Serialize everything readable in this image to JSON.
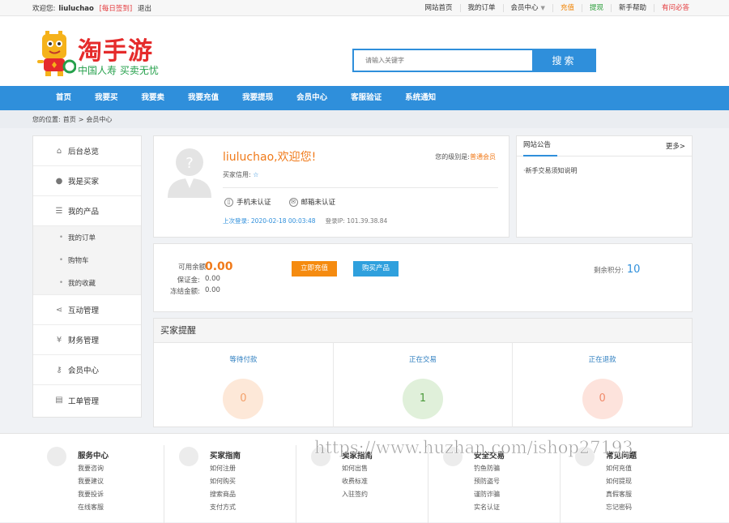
{
  "topbar": {
    "welcome": "欢迎您:",
    "username": "liuluchao",
    "daily_sign": "[每日签到]",
    "logout": "退出",
    "links": [
      "网站首页",
      "我的订单",
      "会员中心",
      "充值",
      "提现",
      "新手帮助",
      "有问必答"
    ]
  },
  "header": {
    "brand": "淘手游",
    "slogan": "中国人寿  买卖无忧",
    "search_placeholder": "请输入关键字",
    "search_button": "搜索"
  },
  "nav": [
    "首页",
    "我要买",
    "我要卖",
    "我要充值",
    "我要提现",
    "会员中心",
    "客服验证",
    "系统通知"
  ],
  "breadcrumb": {
    "label": "您的位置:",
    "home": "首页",
    "sep": ">",
    "current": "会员中心"
  },
  "sidebar": {
    "items": [
      {
        "label": "后台总览",
        "icon": "home-icon"
      },
      {
        "label": "我是买家",
        "icon": "user-icon"
      },
      {
        "label": "我的产品",
        "icon": "list-icon"
      }
    ],
    "sub_items": [
      "我的订单",
      "购物车",
      "我的收藏"
    ],
    "items2": [
      {
        "label": "互动管理",
        "icon": "share-icon"
      },
      {
        "label": "财务管理",
        "icon": "yen-icon"
      },
      {
        "label": "会员中心",
        "icon": "key-icon"
      },
      {
        "label": "工单管理",
        "icon": "clipboard-icon"
      }
    ]
  },
  "profile": {
    "welcome": "liuluchao,欢迎您!",
    "level_label": "您的级别是:",
    "level": "普通会员",
    "credit_label": "买家信用:",
    "phone_auth": "手机未认证",
    "email_auth": "邮箱未认证",
    "last_login": "上次登录:  2020-02-18 00:03:48",
    "login_ip": "登录IP:  101.39.38.84"
  },
  "notice": {
    "tab": "网站公告",
    "more": "更多>",
    "items": [
      "·新手交易须知说明"
    ]
  },
  "balance": {
    "available_label": "可用余额:",
    "available": "0.00",
    "deposit_label": "保证金:",
    "deposit": "0.00",
    "frozen_label": "冻结金额:",
    "frozen": "0.00",
    "recharge_btn": "立即充值",
    "buy_btn": "购买产品",
    "points_label": "剩余积分:",
    "points": "10"
  },
  "alert": {
    "title": "买家提醒",
    "cols": [
      {
        "label": "等待付款",
        "count": "0"
      },
      {
        "label": "正在交易",
        "count": "1"
      },
      {
        "label": "正在退款",
        "count": "0"
      }
    ]
  },
  "footer": [
    {
      "title": "服务中心",
      "links": [
        "我要咨询",
        "我要建议",
        "我要投诉",
        "在线客服"
      ]
    },
    {
      "title": "买家指南",
      "links": [
        "如何注册",
        "如何购买",
        "搜索商品",
        "支付方式"
      ]
    },
    {
      "title": "卖家指南",
      "links": [
        "如何出售",
        "收费标准",
        "入驻签约"
      ]
    },
    {
      "title": "安全交易",
      "links": [
        "钓鱼防骗",
        "预防盗号",
        "谨防诈骗",
        "实名认证"
      ]
    },
    {
      "title": "常见问题",
      "links": [
        "如何充值",
        "如何提现",
        "真假客服",
        "忘记密码"
      ]
    }
  ],
  "watermark": "https://www.huzhan.com/ishop27193",
  "colors": {
    "primary": "#2f8fdb",
    "orange": "#f07a1a",
    "brand_red": "#e52b2b"
  }
}
